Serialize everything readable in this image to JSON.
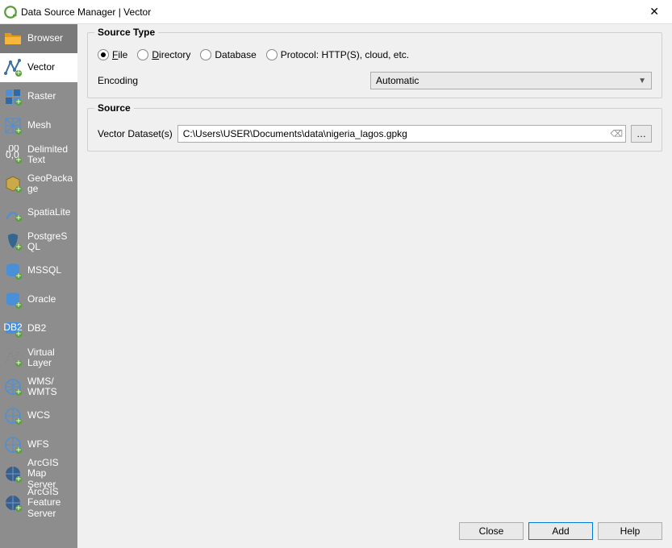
{
  "window": {
    "title": "Data Source Manager | Vector"
  },
  "sidebar": {
    "items": [
      {
        "label": "Browser"
      },
      {
        "label": "Vector"
      },
      {
        "label": "Raster"
      },
      {
        "label": "Mesh"
      },
      {
        "label": "Delimited Text"
      },
      {
        "label": "GeoPackage"
      },
      {
        "label": "SpatiaLite"
      },
      {
        "label": "PostgreSQL"
      },
      {
        "label": "MSSQL"
      },
      {
        "label": "Oracle"
      },
      {
        "label": "DB2"
      },
      {
        "label": "Virtual Layer"
      },
      {
        "label": "WMS/ WMTS"
      },
      {
        "label": "WCS"
      },
      {
        "label": "WFS"
      },
      {
        "label": "ArcGIS Map Server"
      },
      {
        "label": "ArcGIS Feature Server"
      }
    ]
  },
  "sourceType": {
    "group_label": "Source Type",
    "options": {
      "file": {
        "prefix": "F",
        "rest": "ile"
      },
      "directory": {
        "prefix": "D",
        "rest": "irectory"
      },
      "database": {
        "prefix": "",
        "rest": "Database"
      },
      "protocol": {
        "prefix": "",
        "rest": "Protocol: HTTP(S), cloud, etc."
      }
    },
    "encoding_label": "Encoding",
    "encoding_value": "Automatic"
  },
  "source": {
    "group_label": "Source",
    "dataset_label": "Vector Dataset(s)",
    "dataset_value": "C:\\Users\\USER\\Documents\\data\\nigeria_lagos.gpkg",
    "browse_label": "…"
  },
  "footer": {
    "close": "Close",
    "add": "Add",
    "help": "Help"
  }
}
